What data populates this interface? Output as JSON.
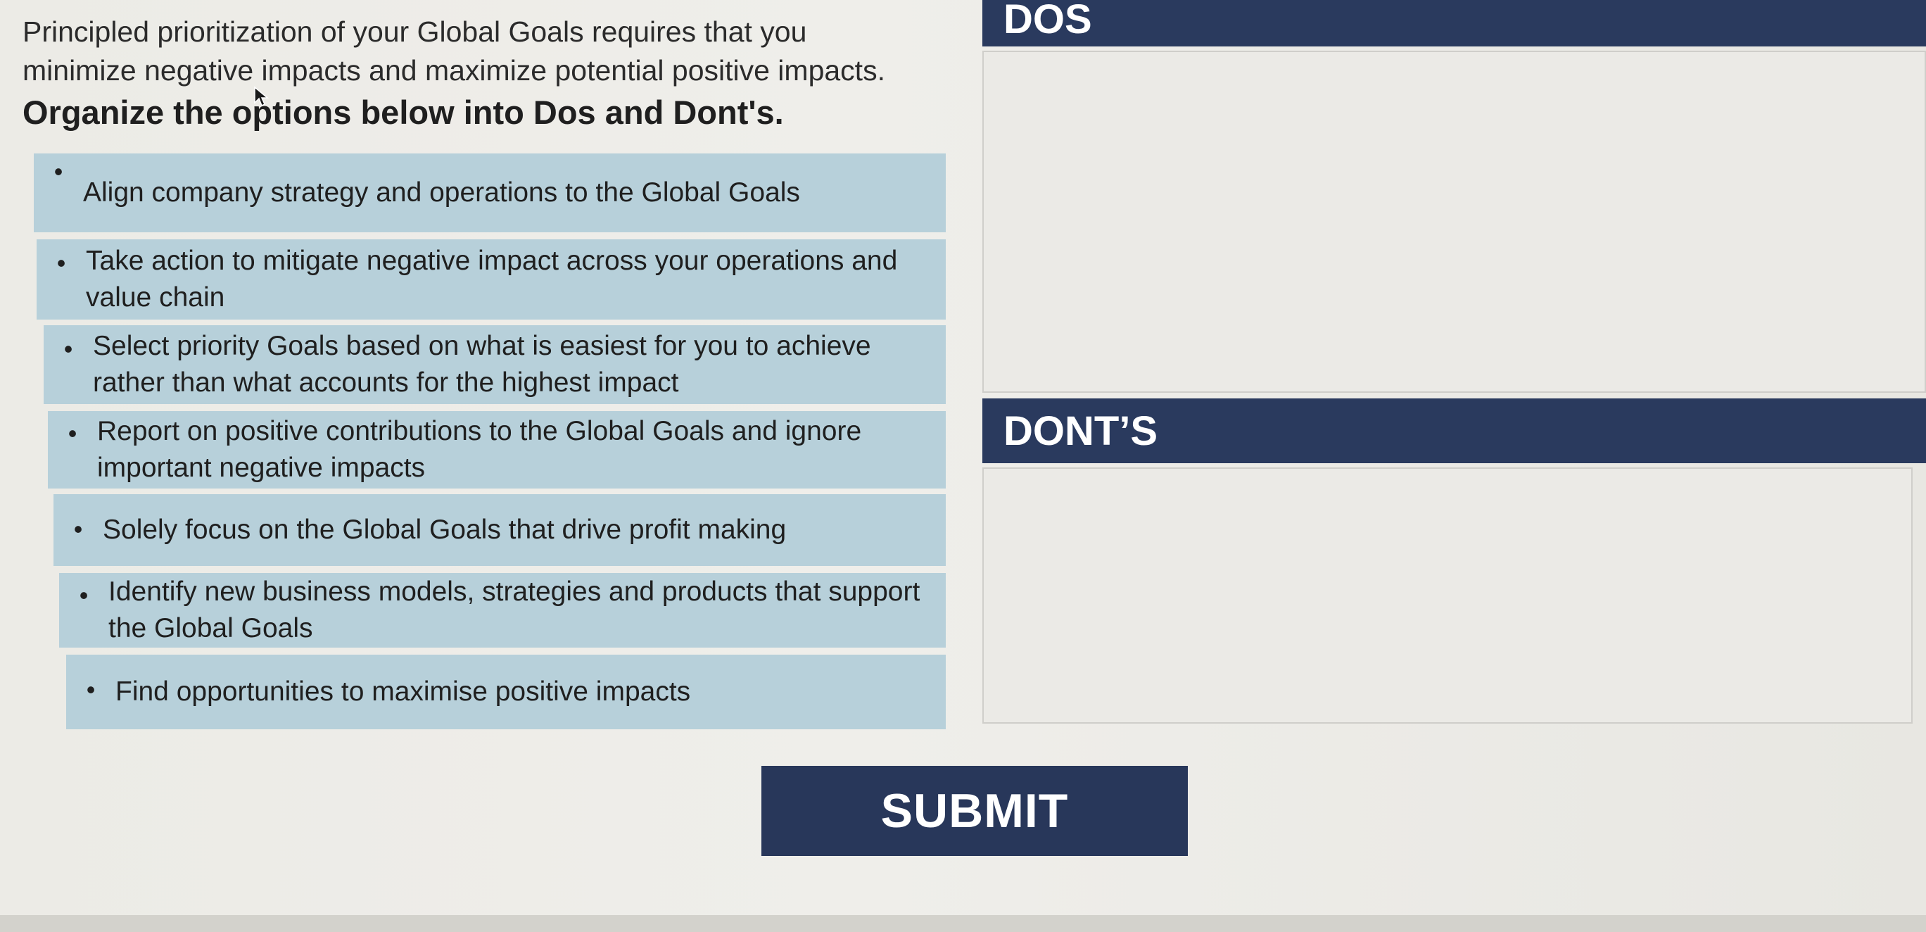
{
  "instructions": {
    "line1": "Principled prioritization of your Global Goals requires that you",
    "line2": "minimize negative impacts and  maximize potential positive impacts.",
    "line3": "Organize the options below into Dos and Dont's."
  },
  "options": [
    {
      "text": "Align company strategy and operations to the Global Goals"
    },
    {
      "text": "Take action to mitigate negative impact across your operations and value chain"
    },
    {
      "text": "Select priority Goals based on what is easiest for you to achieve rather than what accounts for the highest impact"
    },
    {
      "text": "Report on positive contributions to the Global Goals and ignore important negative impacts"
    },
    {
      "text": "Solely focus on the Global Goals that drive profit making"
    },
    {
      "text": "Identify new business models, strategies and products that support the Global Goals"
    },
    {
      "text": "Find opportunities to maximise positive impacts"
    }
  ],
  "bullet": "•",
  "dos": {
    "title": "DOS"
  },
  "donts": {
    "title": "DONT’S"
  },
  "submit": {
    "label": "SUBMIT"
  },
  "colors": {
    "header_bg": "#2a3a5e",
    "option_bg": "#b7d0da",
    "submit_bg": "#28375a"
  },
  "icons": {
    "cursor": "mouse-pointer-icon"
  }
}
